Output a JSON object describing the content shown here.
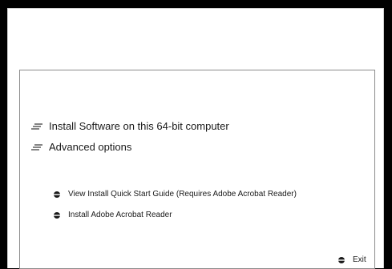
{
  "menu": {
    "items": [
      {
        "label": "Install Software on this 64-bit computer",
        "icon": "lines-icon"
      },
      {
        "label": "Advanced options",
        "icon": "lines-icon"
      }
    ]
  },
  "links": [
    {
      "label": "View Install Quick Start Guide (Requires Adobe Acrobat Reader)",
      "icon": "bullet-icon"
    },
    {
      "label": "Install Adobe Acrobat Reader",
      "icon": "bullet-icon"
    }
  ],
  "footer": {
    "exit_label": "Exit",
    "exit_icon": "bullet-icon"
  },
  "colors": {
    "background": "#000000",
    "window": "#ffffff",
    "panel_border": "#8c8c8c",
    "text": "#1a1a1a"
  }
}
